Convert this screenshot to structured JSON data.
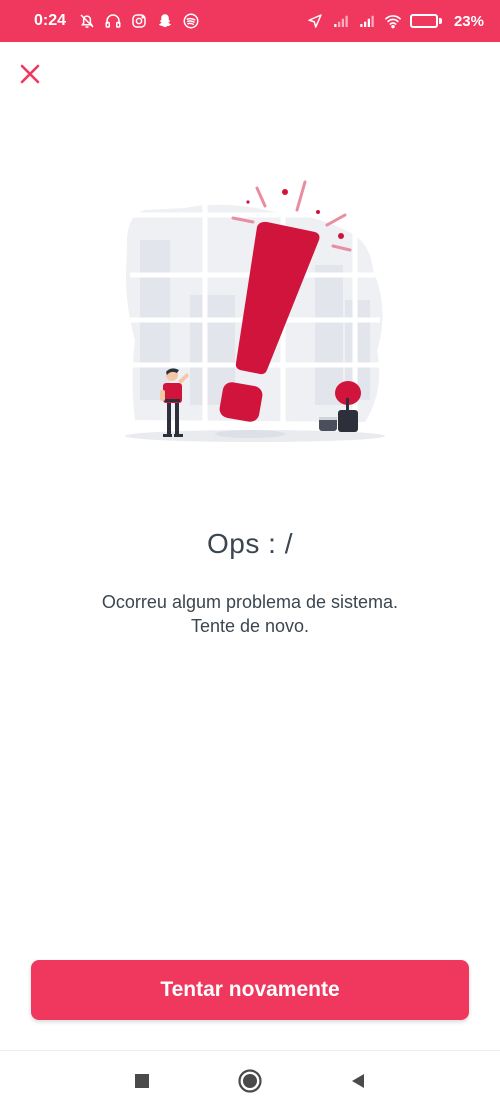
{
  "status_bar": {
    "time": "0:24",
    "battery_text": "23%",
    "icons": [
      "notifications-off-icon",
      "headphones-icon",
      "instagram-icon",
      "snapchat-icon",
      "spotify-icon",
      "location-icon",
      "signal-icon",
      "signal-icon",
      "wifi-icon",
      "battery-icon"
    ],
    "color": "#f0375e"
  },
  "header": {
    "close_icon": "close-icon"
  },
  "illustration": {
    "name": "error-exclamation-illustration",
    "accent": "#d0143b"
  },
  "main": {
    "title": "Ops : /",
    "message_line1": "Ocorreu algum problema de sistema.",
    "message_line2": "Tente de novo."
  },
  "actions": {
    "retry_label": "Tentar novamente",
    "button_color": "#f0375e"
  },
  "nav_bar": {
    "items": [
      "recent-apps-icon",
      "home-icon",
      "back-icon"
    ]
  }
}
